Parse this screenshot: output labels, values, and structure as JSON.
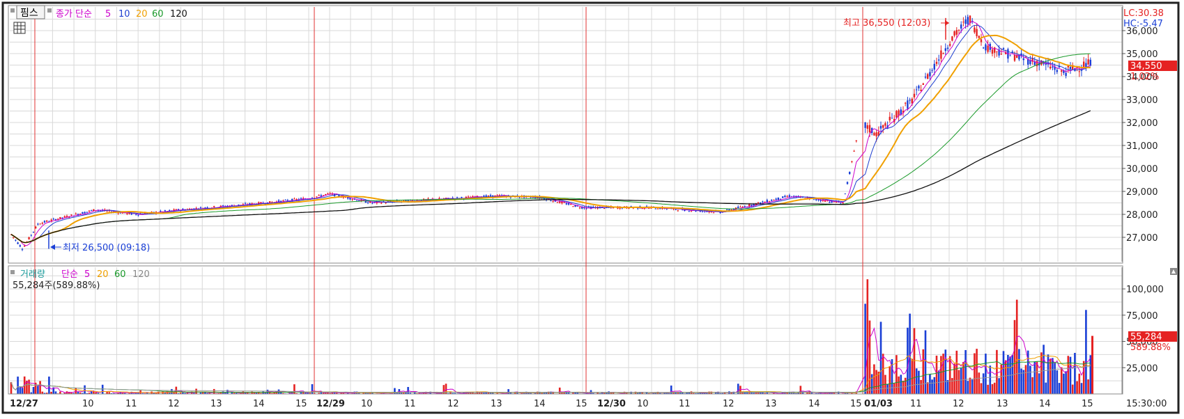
{
  "price_panel": {
    "instrument": "핌스",
    "ma_label": "종가 단순",
    "ma_periods": [
      "5",
      "10",
      "20",
      "60",
      "120"
    ],
    "lc_label": "LC:30.38",
    "hc_label": "HC:-5.47",
    "current_price": "34,550",
    "change_pct": "1.02%",
    "high_annotation": "최고 36,550 (12:03)",
    "low_annotation": "최저 26,500 (09:18)",
    "y_ticks": [
      "36,000",
      "35,000",
      "34,000",
      "33,000",
      "32,000",
      "31,000",
      "30,000",
      "29,000",
      "28,000",
      "27,000"
    ]
  },
  "volume_panel": {
    "label": "거래량",
    "ma_label": "단순",
    "ma_periods": [
      "5",
      "20",
      "60",
      "120"
    ],
    "summary": "55,284주(589.88%)",
    "current_volume": "55,284",
    "current_pct": "589.88%",
    "y_ticks": [
      "100,000",
      "75,000",
      "50,000",
      "25,000"
    ]
  },
  "x_axis": {
    "labels": [
      "12/27",
      "10",
      "11",
      "12",
      "13",
      "14",
      "15",
      "12/29",
      "10",
      "11",
      "12",
      "13",
      "14",
      "15",
      "12/30",
      "10",
      "11",
      "12",
      "13",
      "14",
      "15",
      "01/03",
      "11",
      "12",
      "13",
      "14",
      "15"
    ],
    "end_time": "15:30:00"
  },
  "colors": {
    "up": "#e52222",
    "down": "#1a3fd6",
    "ma5": "#cc00cc",
    "ma10": "#1f3fd0",
    "ma20": "#f0a000",
    "ma60": "#1a9a2a",
    "ma120": "#111111",
    "day_divider": "#e03030",
    "grid": "#d8d8d8"
  },
  "chart_data": {
    "type": "candlestick_with_volume",
    "x_days": [
      "12/27",
      "12/29",
      "12/30",
      "01/03"
    ],
    "price_anchors": [
      {
        "day": "12/27",
        "time": "09:00",
        "price": 27200
      },
      {
        "day": "12/27",
        "time": "09:18",
        "price": 26500
      },
      {
        "day": "12/27",
        "time": "09:40",
        "price": 27600
      },
      {
        "day": "12/27",
        "time": "11:00",
        "price": 28200
      },
      {
        "day": "12/27",
        "time": "12:00",
        "price": 28000
      },
      {
        "day": "12/27",
        "time": "13:00",
        "price": 28200
      },
      {
        "day": "12/27",
        "time": "15:00",
        "price": 28500
      },
      {
        "day": "12/29",
        "time": "09:30",
        "price": 28700
      },
      {
        "day": "12/29",
        "time": "10:00",
        "price": 28900
      },
      {
        "day": "12/29",
        "time": "11:00",
        "price": 28500
      },
      {
        "day": "12/29",
        "time": "14:00",
        "price": 28800
      },
      {
        "day": "12/29",
        "time": "15:00",
        "price": 28750
      },
      {
        "day": "12/30",
        "time": "09:30",
        "price": 28300
      },
      {
        "day": "12/30",
        "time": "11:00",
        "price": 28300
      },
      {
        "day": "12/30",
        "time": "12:30",
        "price": 28100
      },
      {
        "day": "12/30",
        "time": "14:00",
        "price": 28800
      },
      {
        "day": "12/30",
        "time": "15:10",
        "price": 28500
      },
      {
        "day": "01/03",
        "time": "09:03",
        "price": 32000
      },
      {
        "day": "01/03",
        "time": "09:30",
        "price": 31500
      },
      {
        "day": "01/03",
        "time": "10:30",
        "price": 33000
      },
      {
        "day": "01/03",
        "time": "11:30",
        "price": 35500
      },
      {
        "day": "01/03",
        "time": "12:03",
        "price": 36550
      },
      {
        "day": "01/03",
        "time": "12:30",
        "price": 35300
      },
      {
        "day": "01/03",
        "time": "13:30",
        "price": 34800
      },
      {
        "day": "01/03",
        "time": "14:00",
        "price": 34600
      },
      {
        "day": "01/03",
        "time": "14:40",
        "price": 34200
      },
      {
        "day": "01/03",
        "time": "15:20",
        "price": 34550
      }
    ],
    "high": {
      "price": 36550,
      "time": "12:03",
      "day": "01/03"
    },
    "low": {
      "price": 26500,
      "time": "09:18",
      "day": "12/27"
    },
    "price_ylim": [
      26000,
      36600
    ],
    "volume_ylim": [
      0,
      115000
    ],
    "last_volume": 55284
  }
}
